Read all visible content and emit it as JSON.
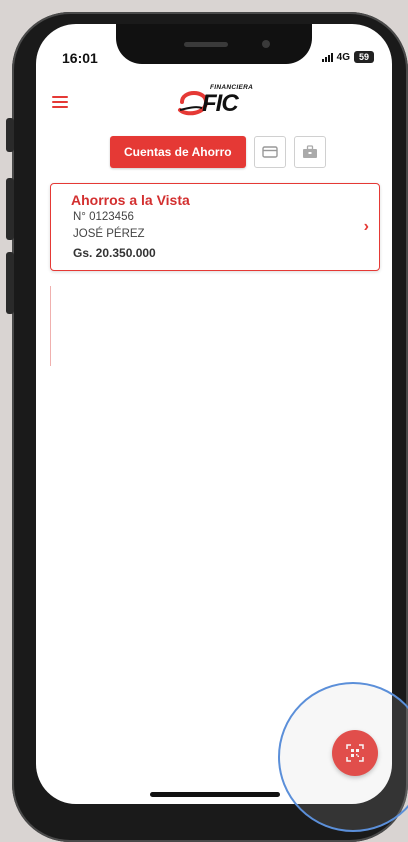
{
  "status_bar": {
    "time": "16:01",
    "network": "4G",
    "battery": "59"
  },
  "header": {
    "logo_small": "FINANCIERA",
    "logo_main": "FIC"
  },
  "tabs": {
    "active_label": "Cuentas de Ahorro"
  },
  "account": {
    "title": "Ahorros a la Vista",
    "number": "N° 0123456",
    "holder": "JOSÉ PÉREZ",
    "balance": "Gs. 20.350.000"
  },
  "colors": {
    "brand_red": "#e53935",
    "highlight_blue": "#5b8fd9"
  },
  "icons": [
    "menu-icon",
    "card-icon",
    "briefcase-icon",
    "chevron-right-icon",
    "qr-scan-icon"
  ]
}
